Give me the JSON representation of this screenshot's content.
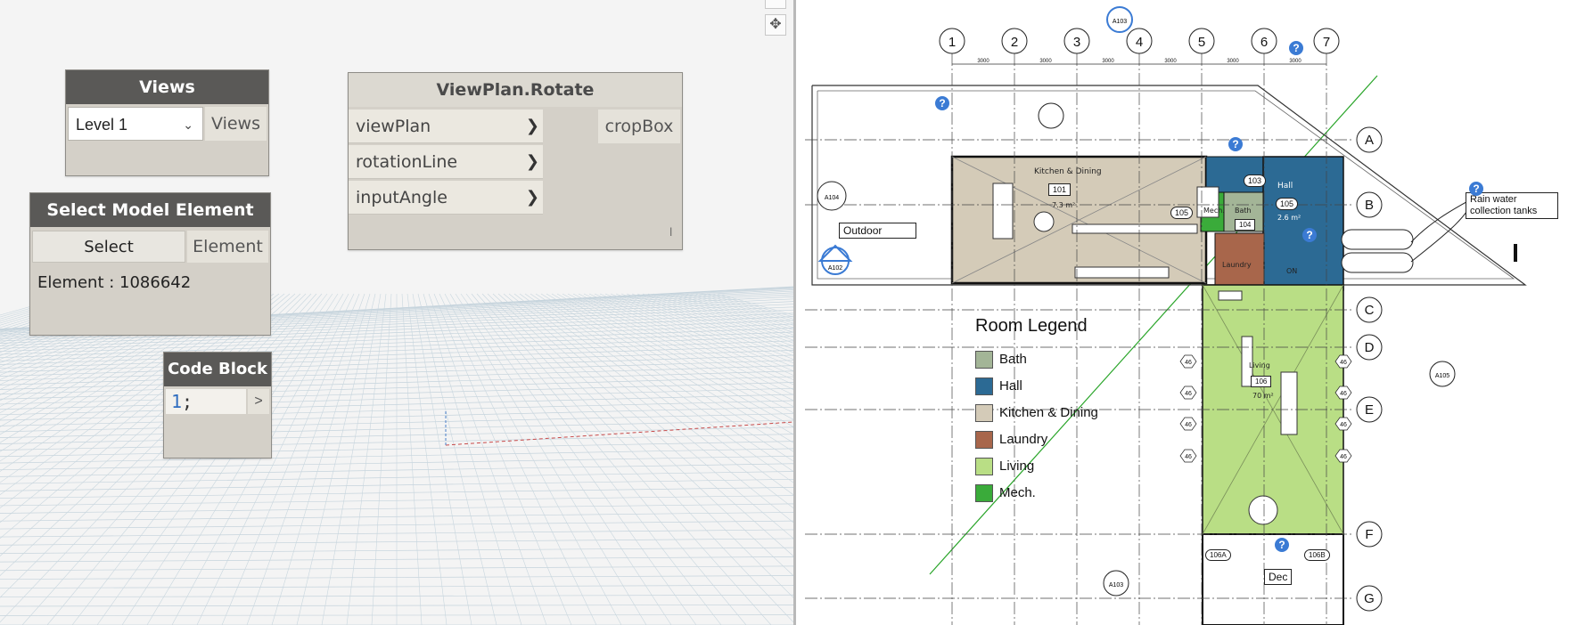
{
  "dynamo": {
    "views_node": {
      "title": "Views",
      "selected": "Level 1",
      "output": "Views"
    },
    "viewplan_node": {
      "title": "ViewPlan.Rotate",
      "inputs": [
        "viewPlan",
        "rotationLine",
        "inputAngle"
      ],
      "output": "cropBox",
      "footer_mark": "l"
    },
    "select_node": {
      "title": "Select Model Element",
      "button": "Select",
      "output": "Element",
      "value": "Element : 1086642"
    },
    "code_node": {
      "title": "Code Block",
      "code_number": "1",
      "code_semicolon": ";",
      "output": ">"
    },
    "toolbar": {
      "zoom_icon": "move-icon"
    }
  },
  "plan": {
    "grid_columns": [
      "1",
      "2",
      "3",
      "4",
      "5",
      "6",
      "7"
    ],
    "grid_rows": [
      "A",
      "B",
      "C",
      "D",
      "E",
      "F",
      "G"
    ],
    "dimension_labels": [
      "3000",
      "3000",
      "3000",
      "3000",
      "3000",
      "3000"
    ],
    "room_labels": {
      "kitchen": "Kitchen & Dining",
      "kitchen_num": "101",
      "kitchen_area": "7.3 m²",
      "hall": "Hall",
      "hall_num": "105",
      "hall_area": "2.6 m²",
      "bath_num": "103",
      "mech_label": "Mech.",
      "bath_tag": "Bath",
      "bath_tag_num": "104",
      "tag_105": "105",
      "laundry": "Laundry",
      "living": "Living",
      "living_num": "106",
      "living_area": "70 m²",
      "outdoor": "Outdoor",
      "deck": "Dec",
      "rain_note": "Rain water collection tanks",
      "section_a105": "A105",
      "section_a103_top": "A103",
      "section_a104": "A104",
      "section_a103": "A103",
      "section_a102": "A102",
      "elev_106a": "106A",
      "elev_106b": "106B",
      "wall_tag": "46",
      "on_label": "ON"
    },
    "legend": {
      "title": "Room Legend",
      "items": [
        {
          "label": "Bath",
          "color": "#a3b597"
        },
        {
          "label": "Hall",
          "color": "#2c6a94"
        },
        {
          "label": "Kitchen & Dining",
          "color": "#d4cbb8"
        },
        {
          "label": "Laundry",
          "color": "#a8664b"
        },
        {
          "label": "Living",
          "color": "#b9de85"
        },
        {
          "label": "Mech.",
          "color": "#3aab3a"
        }
      ]
    },
    "help_icon": "?"
  }
}
